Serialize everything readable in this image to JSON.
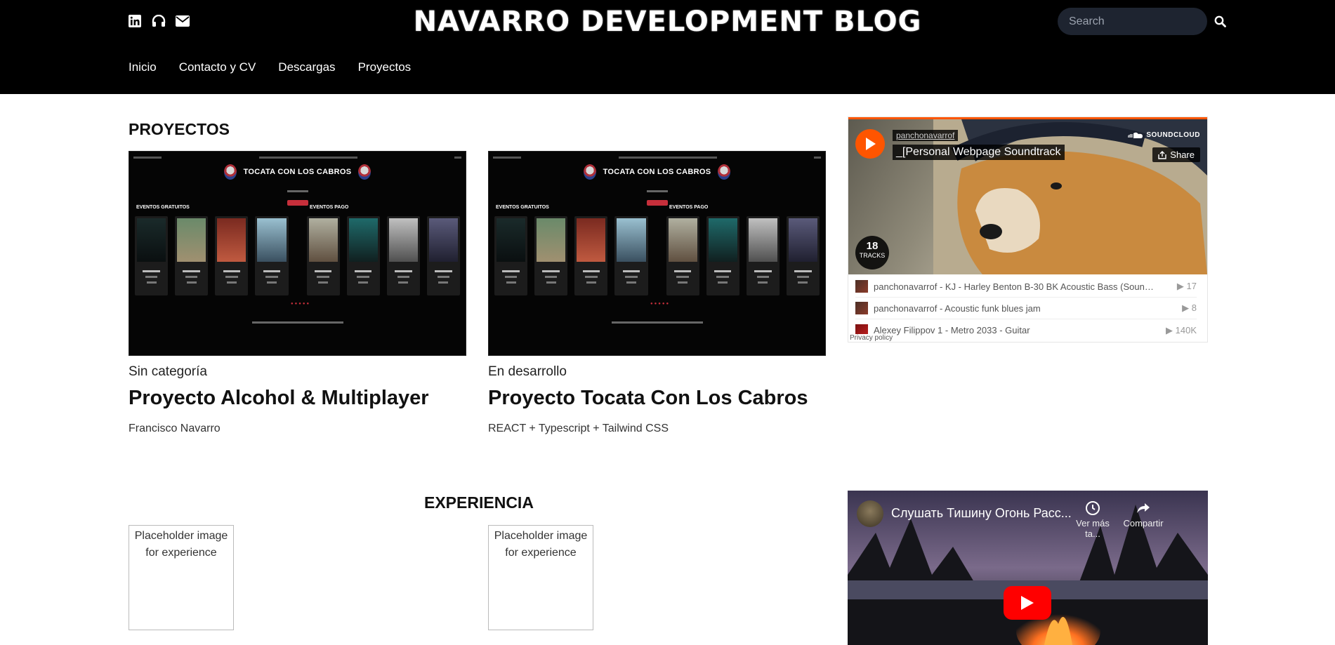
{
  "header": {
    "brand": "NAVARRO DEVELOPMENT BLOG",
    "social_icons": [
      "linkedin-icon",
      "headphones-icon",
      "envelope-icon"
    ],
    "search": {
      "placeholder": "Search"
    },
    "nav": [
      {
        "label": "Inicio"
      },
      {
        "label": "Contacto y CV"
      },
      {
        "label": "Descargas"
      },
      {
        "label": "Proyectos"
      }
    ]
  },
  "projects": {
    "title": "PROYECTOS",
    "cards": [
      {
        "category": "Sin categoría",
        "title": "Proyecto Alcohol & Multiplayer",
        "description": "Francisco Navarro",
        "thumb_title": "TOCATA CON LOS CABROS",
        "group_free": "EVENTOS GRATUITOS",
        "group_paid": "EVENTOS PAGO"
      },
      {
        "category": "En desarrollo",
        "title": "Proyecto Tocata Con Los Cabros",
        "description": "REACT + Typescript + Tailwind CSS",
        "thumb_title": "TOCATA CON LOS CABROS",
        "group_free": "EVENTOS GRATUITOS",
        "group_paid": "EVENTOS PAGO"
      }
    ]
  },
  "soundcloud": {
    "user": "panchonavarrof",
    "playlist": "_[Personal Webpage Soundtrack",
    "brand": "SOUNDCLOUD",
    "share": "Share",
    "track_count": "18",
    "track_count_label": "TRACKS",
    "tracks": [
      {
        "text": "panchonavarrof - KJ - Harley Benton B-30 BK Acoustic Bass (Sound ...",
        "plays": "17"
      },
      {
        "text": "panchonavarrof - Acoustic funk blues jam",
        "plays": "8"
      },
      {
        "text": "Alexey Filippov 1 - Metro 2033 - Guitar",
        "plays": "140K"
      }
    ],
    "privacy": "Privacy policy",
    "accent": "#ff5500"
  },
  "experience": {
    "title": "EXPERIENCIA",
    "items": [
      {
        "alt": "Placeholder image for experience"
      },
      {
        "alt": "Placeholder image for experience"
      }
    ]
  },
  "youtube": {
    "title": "Слушать Тишину Огонь Расс...",
    "watch_later": "Ver más ta...",
    "share": "Compartir",
    "accent": "#ff0000"
  }
}
